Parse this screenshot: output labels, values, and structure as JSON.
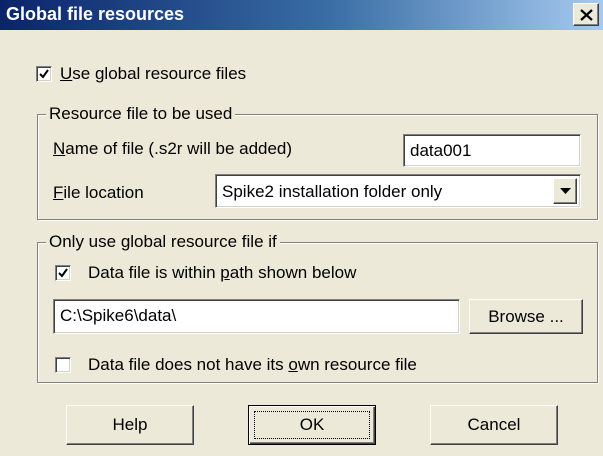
{
  "window": {
    "title": "Global file resources",
    "close_icon": "close-icon"
  },
  "use_global": {
    "checked": true,
    "label_accel": "U",
    "label_rest": "se global resource files"
  },
  "resource_group": {
    "legend": "Resource file to be used",
    "name_label_accel": "N",
    "name_label_rest": "ame of file (.s2r will be added)",
    "name_value": "data001",
    "location_label_accel": "F",
    "location_label_rest": "ile location",
    "location_value": "Spike2 installation folder only"
  },
  "condition_group": {
    "legend_pre": "Only use ",
    "legend_accel": "g",
    "legend_post": "lobal resource file if",
    "path_check": {
      "checked": true,
      "label_pre": "Data file is within ",
      "label_accel": "p",
      "label_post": "ath shown below"
    },
    "path_value": "C:\\Spike6\\data\\",
    "browse_label": "Browse ...",
    "own_check": {
      "checked": false,
      "label_pre": "Data file does not have its ",
      "label_accel": "o",
      "label_post": "wn resource file"
    }
  },
  "buttons": {
    "help": "Help",
    "ok": "OK",
    "cancel": "Cancel"
  }
}
